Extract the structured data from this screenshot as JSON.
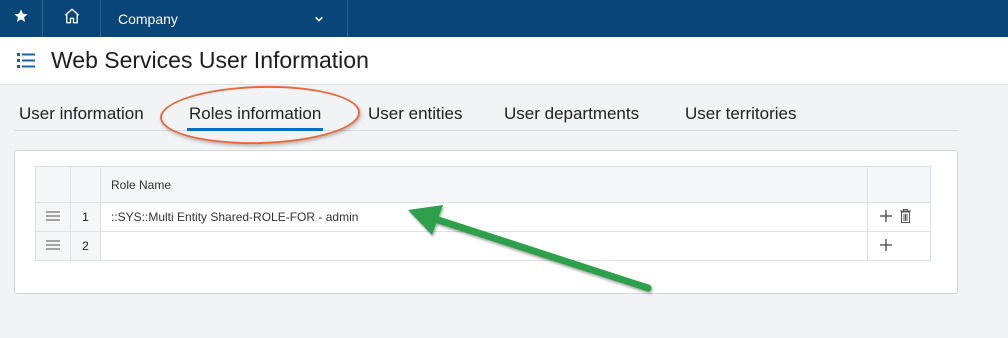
{
  "topbar": {
    "company_label": "Company",
    "icons": [
      "star-icon",
      "home-icon",
      "chevron-down-icon"
    ],
    "colors": {
      "background": "#0a4578"
    }
  },
  "header": {
    "title": "Web Services User Information",
    "icon": "list-icon"
  },
  "tabs": [
    {
      "label": "User information"
    },
    {
      "label": "Roles information",
      "active": true
    },
    {
      "label": "User entities"
    },
    {
      "label": "User departments"
    },
    {
      "label": "User territories"
    }
  ],
  "roles_table": {
    "columns": [
      "",
      "",
      "Role Name",
      ""
    ],
    "rows": [
      {
        "number": "1",
        "role_name": "::SYS::Multi Entity Shared-ROLE-FOR - admin",
        "actions": [
          "add-icon",
          "trash-icon"
        ]
      },
      {
        "number": "2",
        "role_name": "",
        "actions": [
          "add-icon"
        ]
      }
    ]
  },
  "annotations": {
    "ellipse_color": "#e9683b",
    "arrow_color": "#2fa04b"
  }
}
